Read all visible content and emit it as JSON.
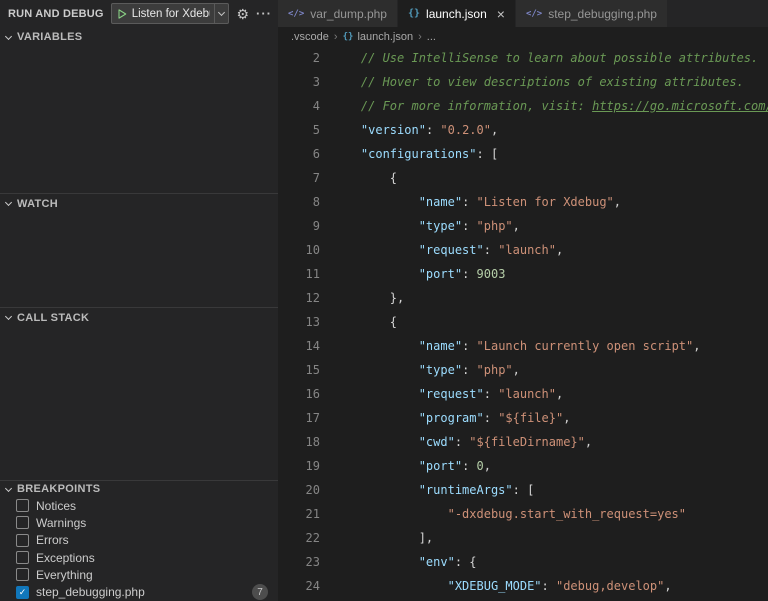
{
  "palette": {
    "editor_bg": "#1E1E1E",
    "sidebar_bg": "#252526",
    "tab_inactive_bg": "#2D2D2D",
    "accent_checkbox_blue": "#1177BB",
    "play_green": "#89D185",
    "comment_green": "#6A9955",
    "key_blue": "#9CDCFE",
    "string_orange": "#CE9178",
    "number_green": "#B5CEA8",
    "punctuation": "#D4D4D4",
    "json_icon_blue": "#519ABA",
    "php_icon_purple": "#7E86C8"
  },
  "icons": {
    "gear": "⚙",
    "more": "···",
    "close": "×",
    "check": "✓",
    "breadcrumb_sep": "›",
    "json": "{}",
    "php": "</>"
  },
  "sidebar": {
    "toolbar": {
      "title": "RUN AND DEBUG",
      "config_label": "Listen for Xdebug"
    },
    "sections": [
      {
        "label": "VARIABLES"
      },
      {
        "label": "WATCH"
      },
      {
        "label": "CALL STACK"
      },
      {
        "label": "BREAKPOINTS"
      }
    ],
    "breakpoints": [
      {
        "label": "Notices",
        "checked": false
      },
      {
        "label": "Warnings",
        "checked": false
      },
      {
        "label": "Errors",
        "checked": false
      },
      {
        "label": "Exceptions",
        "checked": false
      },
      {
        "label": "Everything",
        "checked": false
      },
      {
        "label": "step_debugging.php",
        "checked": true,
        "badge": "7"
      }
    ]
  },
  "editor": {
    "tabs": [
      {
        "label": "var_dump.php",
        "icon": "php",
        "active": false,
        "closable": false
      },
      {
        "label": "launch.json",
        "icon": "json",
        "active": true,
        "closable": true
      },
      {
        "label": "step_debugging.php",
        "icon": "php",
        "active": false,
        "closable": false
      }
    ],
    "breadcrumb": [
      {
        "label": ".vscode"
      },
      {
        "label": "launch.json",
        "icon": "json"
      },
      {
        "label": "..."
      }
    ],
    "lines": [
      {
        "num": 2,
        "indent": 4,
        "tokens": [
          [
            "c",
            "// Use IntelliSense to learn about possible attributes."
          ]
        ]
      },
      {
        "num": 3,
        "indent": 4,
        "tokens": [
          [
            "c",
            "// Hover to view descriptions of existing attributes."
          ]
        ]
      },
      {
        "num": 4,
        "indent": 4,
        "tokens": [
          [
            "c",
            "// For more information, visit: "
          ],
          [
            "l",
            "https://go.microsoft.com/fw"
          ]
        ]
      },
      {
        "num": 5,
        "indent": 4,
        "tokens": [
          [
            "k",
            "\"version\""
          ],
          [
            "p",
            ": "
          ],
          [
            "s",
            "\"0.2.0\""
          ],
          [
            "p",
            ","
          ]
        ]
      },
      {
        "num": 6,
        "indent": 4,
        "tokens": [
          [
            "k",
            "\"configurations\""
          ],
          [
            "p",
            ": ["
          ]
        ]
      },
      {
        "num": 7,
        "indent": 8,
        "tokens": [
          [
            "p",
            "{"
          ]
        ]
      },
      {
        "num": 8,
        "indent": 12,
        "tokens": [
          [
            "k",
            "\"name\""
          ],
          [
            "p",
            ": "
          ],
          [
            "s",
            "\"Listen for Xdebug\""
          ],
          [
            "p",
            ","
          ]
        ]
      },
      {
        "num": 9,
        "indent": 12,
        "tokens": [
          [
            "k",
            "\"type\""
          ],
          [
            "p",
            ": "
          ],
          [
            "s",
            "\"php\""
          ],
          [
            "p",
            ","
          ]
        ]
      },
      {
        "num": 10,
        "indent": 12,
        "tokens": [
          [
            "k",
            "\"request\""
          ],
          [
            "p",
            ": "
          ],
          [
            "s",
            "\"launch\""
          ],
          [
            "p",
            ","
          ]
        ]
      },
      {
        "num": 11,
        "indent": 12,
        "tokens": [
          [
            "k",
            "\"port\""
          ],
          [
            "p",
            ": "
          ],
          [
            "n",
            "9003"
          ]
        ]
      },
      {
        "num": 12,
        "indent": 8,
        "tokens": [
          [
            "p",
            "},"
          ]
        ]
      },
      {
        "num": 13,
        "indent": 8,
        "tokens": [
          [
            "p",
            "{"
          ]
        ]
      },
      {
        "num": 14,
        "indent": 12,
        "tokens": [
          [
            "k",
            "\"name\""
          ],
          [
            "p",
            ": "
          ],
          [
            "s",
            "\"Launch currently open script\""
          ],
          [
            "p",
            ","
          ]
        ]
      },
      {
        "num": 15,
        "indent": 12,
        "tokens": [
          [
            "k",
            "\"type\""
          ],
          [
            "p",
            ": "
          ],
          [
            "s",
            "\"php\""
          ],
          [
            "p",
            ","
          ]
        ]
      },
      {
        "num": 16,
        "indent": 12,
        "tokens": [
          [
            "k",
            "\"request\""
          ],
          [
            "p",
            ": "
          ],
          [
            "s",
            "\"launch\""
          ],
          [
            "p",
            ","
          ]
        ]
      },
      {
        "num": 17,
        "indent": 12,
        "tokens": [
          [
            "k",
            "\"program\""
          ],
          [
            "p",
            ": "
          ],
          [
            "s",
            "\"${file}\""
          ],
          [
            "p",
            ","
          ]
        ]
      },
      {
        "num": 18,
        "indent": 12,
        "tokens": [
          [
            "k",
            "\"cwd\""
          ],
          [
            "p",
            ": "
          ],
          [
            "s",
            "\"${fileDirname}\""
          ],
          [
            "p",
            ","
          ]
        ]
      },
      {
        "num": 19,
        "indent": 12,
        "tokens": [
          [
            "k",
            "\"port\""
          ],
          [
            "p",
            ": "
          ],
          [
            "n",
            "0"
          ],
          [
            "p",
            ","
          ]
        ]
      },
      {
        "num": 20,
        "indent": 12,
        "tokens": [
          [
            "k",
            "\"runtimeArgs\""
          ],
          [
            "p",
            ": ["
          ]
        ]
      },
      {
        "num": 21,
        "indent": 16,
        "tokens": [
          [
            "s",
            "\"-dxdebug.start_with_request=yes\""
          ]
        ]
      },
      {
        "num": 22,
        "indent": 12,
        "tokens": [
          [
            "p",
            "],"
          ]
        ]
      },
      {
        "num": 23,
        "indent": 12,
        "tokens": [
          [
            "k",
            "\"env\""
          ],
          [
            "p",
            ": {"
          ]
        ]
      },
      {
        "num": 24,
        "indent": 16,
        "tokens": [
          [
            "k",
            "\"XDEBUG_MODE\""
          ],
          [
            "p",
            ": "
          ],
          [
            "s",
            "\"debug,develop\""
          ],
          [
            "p",
            ","
          ]
        ]
      }
    ]
  }
}
